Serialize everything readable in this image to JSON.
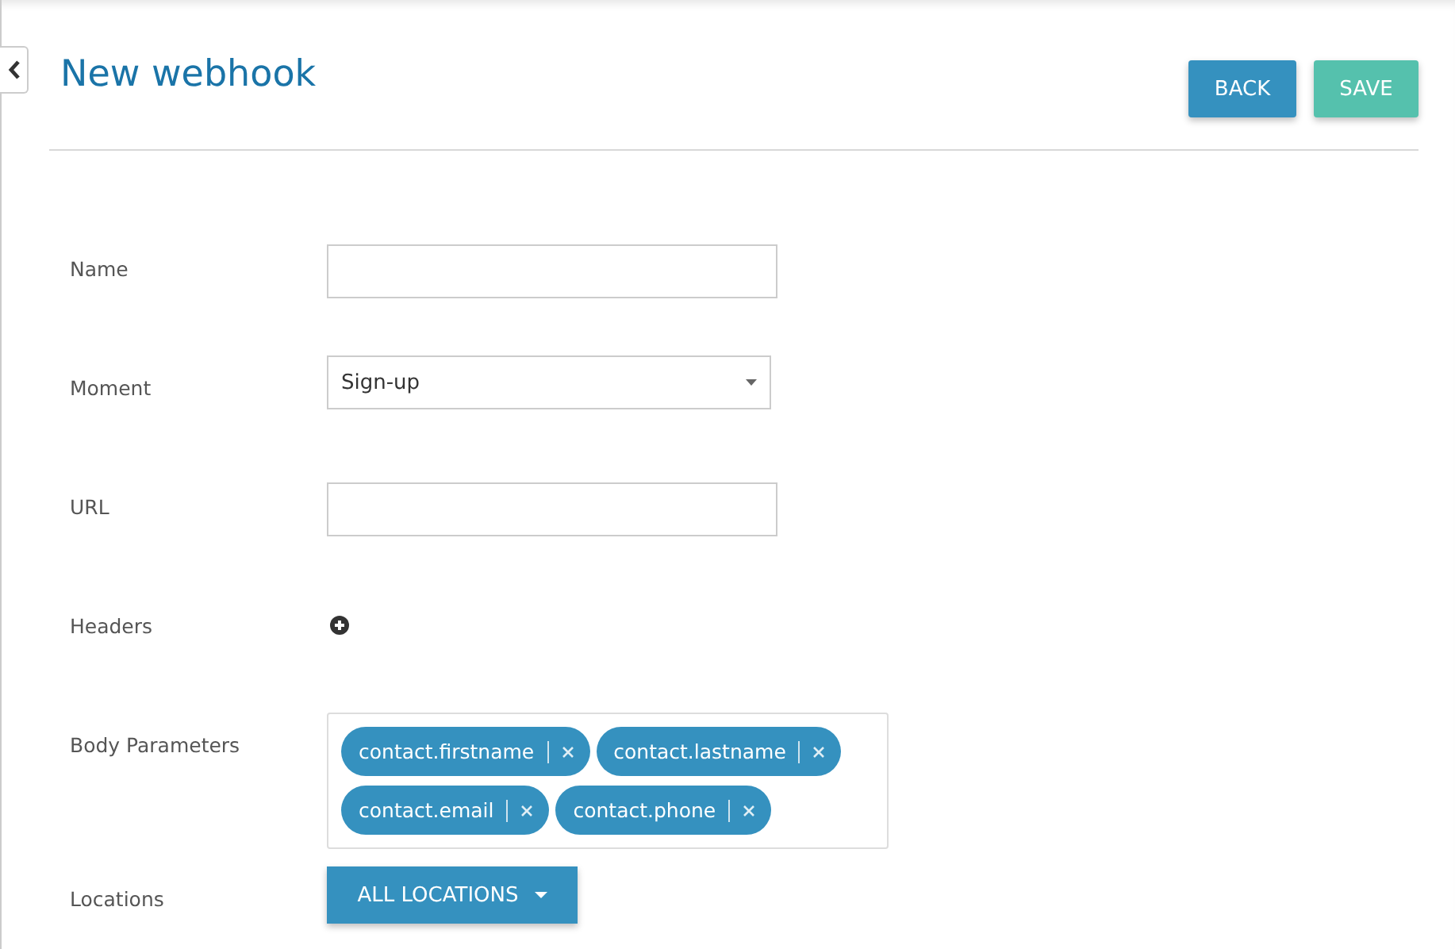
{
  "title": "New webhook",
  "buttons": [
    {
      "label": "BACK",
      "kind": "back"
    },
    {
      "label": "SAVE",
      "kind": "save"
    }
  ],
  "fields": [
    {
      "label": "Name",
      "kind": "text"
    },
    {
      "label": "Moment",
      "kind": "select",
      "value": "Sign-up"
    },
    {
      "label": "URL",
      "kind": "text"
    },
    {
      "label": "Headers",
      "kind": "add"
    },
    {
      "label": "Body Parameters",
      "kind": "tags",
      "tags": [
        "contact.firstname",
        "contact.lastname",
        "contact.email",
        "contact.phone"
      ]
    },
    {
      "label": "Locations",
      "kind": "dropdown",
      "value": "ALL LOCATIONS"
    }
  ]
}
